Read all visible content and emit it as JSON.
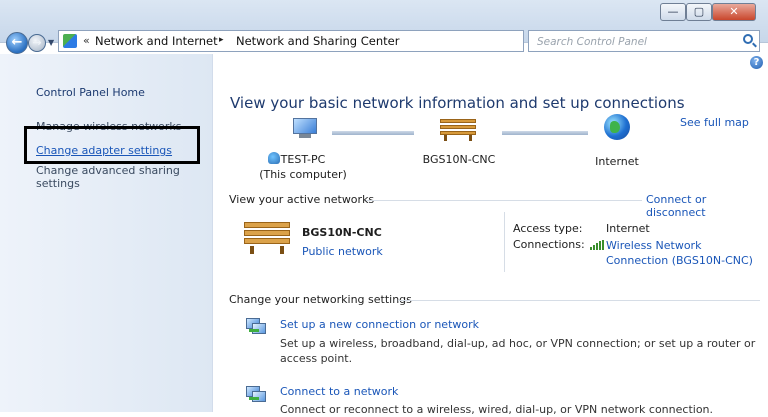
{
  "window": {
    "min_label": "—",
    "max_label": "▢",
    "close_label": "✕"
  },
  "address_bar": {
    "overflow": "«",
    "crumbs": [
      "Network and Internet",
      "Network and Sharing Center"
    ],
    "separator": "▸",
    "dropdown": "▾",
    "refresh": "↻"
  },
  "search": {
    "placeholder": "Search Control Panel"
  },
  "sidebar": {
    "home": "Control Panel Home",
    "wireless": "Manage wireless networks",
    "adapter": "Change adapter settings",
    "sharing": "Change advanced sharing settings"
  },
  "main": {
    "title": "View your basic network information and set up connections",
    "see_full_map": "See full map",
    "help": "?",
    "nodes": {
      "pc_name": "TEST-PC",
      "pc_sub": "(This computer)",
      "network": "BGS10N-CNC",
      "internet": "Internet"
    },
    "active": {
      "heading": "View your active networks",
      "connect_link": "Connect or disconnect",
      "name": "BGS10N-CNC",
      "type": "Public network",
      "access_label": "Access type:",
      "access_value": "Internet",
      "connections_label": "Connections:",
      "connections_value": "Wireless Network Connection (BGS10N-CNC)"
    },
    "settings": {
      "heading": "Change your networking settings",
      "tasks": [
        {
          "title": "Set up a new connection or network",
          "desc": "Set up a wireless, broadband, dial-up, ad hoc, or VPN connection; or set up a router or access point."
        },
        {
          "title": "Connect to a network",
          "desc": "Connect or reconnect to a wireless, wired, dial-up, or VPN network connection."
        }
      ]
    }
  },
  "colors": {
    "link": "#1a56b8",
    "title": "#1e3a6e",
    "sidebar": "#e6eef8",
    "highlight_box": "#000000"
  }
}
